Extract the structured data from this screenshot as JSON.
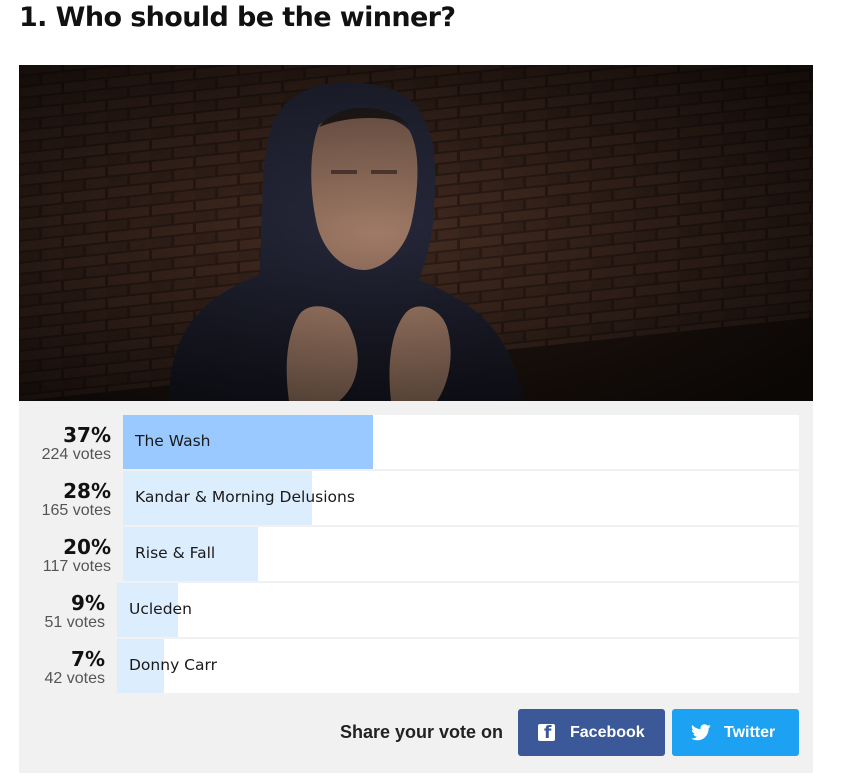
{
  "question": {
    "title": "1. Who should be the winner?"
  },
  "poll": {
    "options": [
      {
        "percent_label": "37%",
        "percent": 37,
        "votes_label": "224 votes",
        "name": "The Wash",
        "leading": true
      },
      {
        "percent_label": "28%",
        "percent": 28,
        "votes_label": "165 votes",
        "name": "Kandar & Morning Delusions",
        "leading": false
      },
      {
        "percent_label": "20%",
        "percent": 20,
        "votes_label": "117 votes",
        "name": "Rise & Fall",
        "leading": false
      },
      {
        "percent_label": "9%",
        "percent": 9,
        "votes_label": "51 votes",
        "name": "Ucleden",
        "leading": false
      },
      {
        "percent_label": "7%",
        "percent": 7,
        "votes_label": "42 votes",
        "name": "Donny Carr",
        "leading": false
      }
    ]
  },
  "share": {
    "prompt": "Share your vote on",
    "facebook_label": "Facebook",
    "twitter_label": "Twitter"
  },
  "colors": {
    "leading_bar": "#99c9fe",
    "other_bar": "#dcedfe",
    "facebook": "#3b5998",
    "twitter": "#1da1f2",
    "panel": "#f1f1f1"
  },
  "icons": {
    "facebook": "facebook-icon",
    "twitter": "twitter-bird-icon"
  }
}
